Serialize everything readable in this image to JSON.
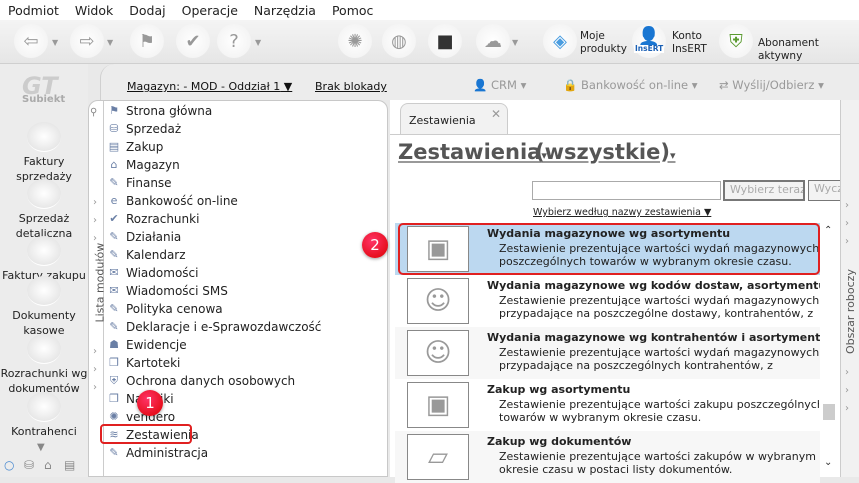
{
  "menu": [
    "Podmiot",
    "Widok",
    "Dodaj",
    "Operacje",
    "Narzędzia",
    "Pomoc"
  ],
  "toolbar": {
    "moje_produkty": "Moje\nprodukty",
    "konto": "Konto\nInsERT",
    "abonament": "Abonament aktywny",
    "insert_logo": "InsERT"
  },
  "subbar": {
    "magazyn": "Magazyn: - MOD - Oddział 1",
    "blokady": "Brak blokady",
    "crm": "CRM",
    "bankowosc": "Bankowość on-line",
    "wyslij": "Wyślij/Odbierz"
  },
  "app": {
    "logo": "Subiekt"
  },
  "leftbar": [
    "Faktury sprzedaży",
    "Sprzedaż detaliczna",
    "Faktury zakupu",
    "Dokumenty kasowe",
    "Rozrachunki wg dokumentów",
    "Kontrahenci"
  ],
  "modules": {
    "title": "Lista modułów",
    "items": [
      "Strona główna",
      "Sprzedaż",
      "Zakup",
      "Magazyn",
      "Finanse",
      "Bankowość on-line",
      "Rozrachunki",
      "Działania",
      "Kalendarz",
      "Wiadomości",
      "Wiadomości SMS",
      "Polityka cenowa",
      "Deklaracje i e-Sprawozdawczość",
      "Ewidencje",
      "Kartoteki",
      "Ochrona danych osobowych",
      "Naklejki",
      "vendero",
      "Zestawienia",
      "Administracja"
    ]
  },
  "main": {
    "tab": "Zestawienia",
    "heading": "Zestawienia",
    "filter": "(wszystkie)",
    "search_value": "",
    "btn_select": "Wybierz teraz",
    "btn_clear": "Wyczyść",
    "by_link": "Wybierz według nazwy zestawienia",
    "rows": [
      {
        "title": "Wydania magazynowe wg asortymentu",
        "desc1": "Zestawienie prezentujące wartości wydań magazynowych",
        "desc2": "poszczególnych towarów w wybranym okresie czasu.",
        "icon": "boxes-icon"
      },
      {
        "title": "Wydania magazynowe wg kodów dostaw, asortymentu i kontrahentów",
        "desc1": "Zestawienie prezentujące wartości wydań magazynowych",
        "desc2": "przypadające na poszczególne dostawy, kontrahentów, z",
        "icon": "person-icon"
      },
      {
        "title": "Wydania magazynowe wg kontrahentów i asortymentu",
        "desc1": "Zestawienie prezentujące wartości wydań magazynowych",
        "desc2": "przypadające na poszczególnych kontrahentów, z",
        "icon": "person-icon"
      },
      {
        "title": "Zakup wg asortymentu",
        "desc1": "Zestawienie prezentujące wartości zakupu poszczególnych",
        "desc2": "towarów w wybranym okresie czasu.",
        "icon": "boxes-icon"
      },
      {
        "title": "Zakup wg dokumentów",
        "desc1": "Zestawienie prezentujące wartości zakupów w wybranym",
        "desc2": "okresie czasu w postaci listy dokumentów.",
        "icon": "documents-icon"
      }
    ]
  },
  "workspace": "Obszar roboczy",
  "badges": [
    "1",
    "2"
  ],
  "colors": {
    "highlight": "#e02020",
    "selected_row": "#bcd8f0"
  }
}
